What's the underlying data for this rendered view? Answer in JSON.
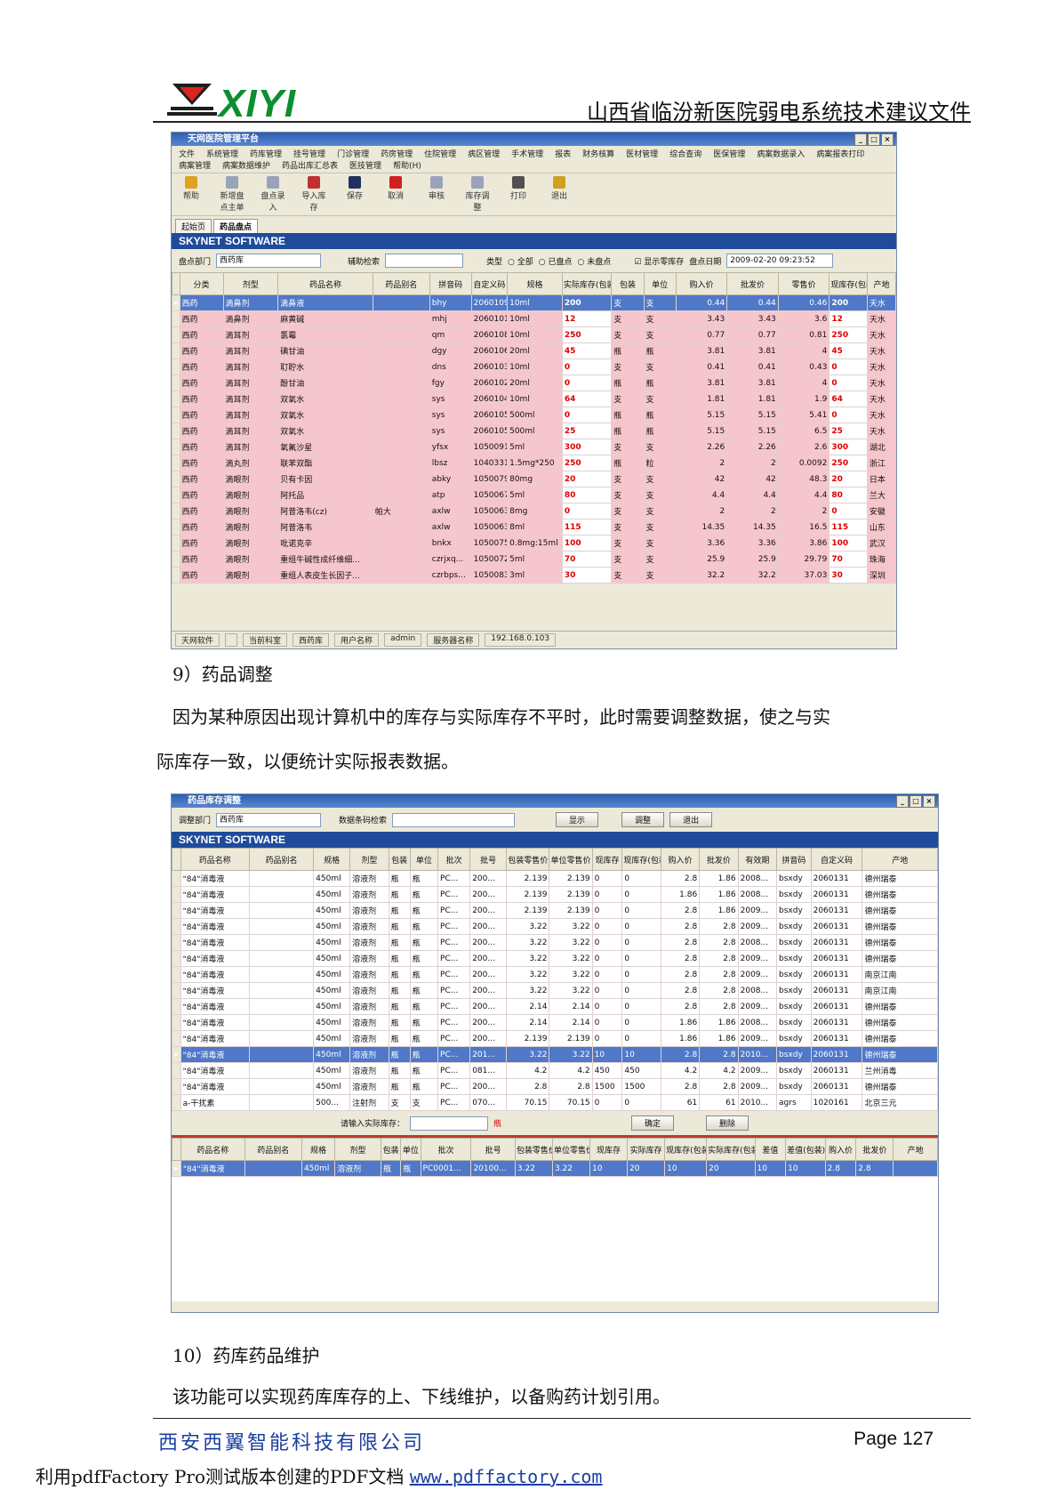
{
  "header": {
    "logo_text": "XIYI",
    "doc_title": "山西省临汾新医院弱电系统技术建议文件"
  },
  "colors": {
    "brand_green": "#0c8f2f",
    "window_blue": "#1f4b9a",
    "row_pink": "#f7c6cc",
    "row_selected": "#4f78c8"
  },
  "win1": {
    "title": "天网医院管理平台",
    "menu": [
      "文件",
      "系统管理",
      "药库管理",
      "挂号管理",
      "门诊管理",
      "药房管理",
      "住院管理",
      "病区管理",
      "手术管理",
      "报表",
      "财务核算",
      "医材管理",
      "综合查询",
      "医保管理",
      "病案数据录入",
      "病案报表打印",
      "病案管理",
      "病案数据维护",
      "药品出库汇总表",
      "医技管理",
      "帮助(H)"
    ],
    "toolbar": [
      "帮助",
      "新增盘点主单",
      "盘点录入",
      "导入库存",
      "保存",
      "取消",
      "审核",
      "库存调整",
      "打印",
      "退出"
    ],
    "tabs": [
      "起始页",
      "药品盘点"
    ],
    "banner": "SKYNET SOFTWARE",
    "filters": {
      "dept_label": "盘点部门",
      "dept_value": "西药库",
      "search_label": "辅助检索",
      "search_value": "",
      "type_label": "类型",
      "type_options": [
        "全部",
        "已盘点",
        "未盘点"
      ],
      "show_zero_label": "显示零库存",
      "date_label": "盘点日期",
      "date_value": "2009-02-20 09:23:52"
    },
    "columns": [
      "分类",
      "剂型",
      "药品名称",
      "药品别名",
      "拼音码",
      "自定义码",
      "规格",
      "实际库存(包装)",
      "包装",
      "单位",
      "购入价",
      "批发价",
      "零售价",
      "现库存(包装)",
      "产地"
    ],
    "rows": [
      [
        "西药",
        "滴鼻剂",
        "滴鼻液",
        "",
        "bhy",
        "2060109",
        "10ml",
        "200",
        "支",
        "支",
        "0.44",
        "0.44",
        "0.46",
        "200",
        "天水"
      ],
      [
        "西药",
        "滴鼻剂",
        "麻黄碱",
        "",
        "mhj",
        "2060101",
        "10ml",
        "12",
        "支",
        "支",
        "3.43",
        "3.43",
        "3.6",
        "12",
        "天水"
      ],
      [
        "西药",
        "滴耳剂",
        "氯霉",
        "",
        "qm",
        "2060108",
        "10ml",
        "250",
        "支",
        "支",
        "0.77",
        "0.77",
        "0.81",
        "250",
        "天水"
      ],
      [
        "西药",
        "滴耳剂",
        "碘甘油",
        "",
        "dgy",
        "2060106",
        "20ml",
        "45",
        "瓶",
        "瓶",
        "3.81",
        "3.81",
        "4",
        "45",
        "天水"
      ],
      [
        "西药",
        "滴耳剂",
        "耵聍水",
        "",
        "dns",
        "2060103",
        "10ml",
        "0",
        "支",
        "支",
        "0.41",
        "0.41",
        "0.43",
        "0",
        "天水"
      ],
      [
        "西药",
        "滴耳剂",
        "酚甘油",
        "",
        "fgy",
        "2060102",
        "20ml",
        "0",
        "瓶",
        "瓶",
        "3.81",
        "3.81",
        "4",
        "0",
        "天水"
      ],
      [
        "西药",
        "滴耳剂",
        "双氧水",
        "",
        "sys",
        "2060104",
        "10ml",
        "64",
        "支",
        "支",
        "1.81",
        "1.81",
        "1.9",
        "64",
        "天水"
      ],
      [
        "西药",
        "滴耳剂",
        "双氧水",
        "",
        "sys",
        "2060105",
        "500ml",
        "0",
        "瓶",
        "瓶",
        "5.15",
        "5.15",
        "5.41",
        "0",
        "天水"
      ],
      [
        "西药",
        "滴耳剂",
        "双氧水",
        "",
        "sys",
        "2060105",
        "500ml",
        "25",
        "瓶",
        "瓶",
        "5.15",
        "5.15",
        "6.5",
        "25",
        "天水"
      ],
      [
        "西药",
        "滴耳剂",
        "氧氟沙星",
        "",
        "yfsx",
        "1050091",
        "5ml",
        "300",
        "支",
        "支",
        "2.26",
        "2.26",
        "2.6",
        "300",
        "湖北"
      ],
      [
        "西药",
        "滴丸剂",
        "联苯双酯",
        "",
        "lbsz",
        "1040331",
        "1.5mg*250",
        "250",
        "瓶",
        "粒",
        "2",
        "2",
        "0.0092",
        "250",
        "浙江"
      ],
      [
        "西药",
        "滴眼剂",
        "贝有卡因",
        "",
        "abky",
        "1050079",
        "80mg",
        "20",
        "支",
        "支",
        "42",
        "42",
        "48.3",
        "20",
        "日本"
      ],
      [
        "西药",
        "滴眼剂",
        "阿托品",
        "",
        "atp",
        "1050067",
        "5ml",
        "80",
        "支",
        "支",
        "4.4",
        "4.4",
        "4.4",
        "80",
        "兰大"
      ],
      [
        "西药",
        "滴眼剂",
        "阿昔洛韦(cz)",
        "帕大",
        "axlw",
        "1050063",
        "8mg",
        "0",
        "支",
        "支",
        "2",
        "2",
        "2",
        "0",
        "安徽"
      ],
      [
        "西药",
        "滴眼剂",
        "阿昔洛韦",
        "",
        "axlw",
        "1050063",
        "8ml",
        "115",
        "支",
        "支",
        "14.35",
        "14.35",
        "16.5",
        "115",
        "山东"
      ],
      [
        "西药",
        "滴眼剂",
        "吡诺克辛",
        "",
        "bnkx",
        "1050075",
        "0.8mg:15ml",
        "100",
        "支",
        "支",
        "3.36",
        "3.36",
        "3.86",
        "100",
        "武汉"
      ],
      [
        "西药",
        "滴眼剂",
        "重组牛碱性成纤维细...",
        "",
        "czrjxq...",
        "1050072",
        "5ml",
        "70",
        "支",
        "支",
        "25.9",
        "25.9",
        "29.79",
        "70",
        "珠海"
      ],
      [
        "西药",
        "滴眼剂",
        "重组人表皮生长因子...",
        "",
        "czrbps...",
        "1050083",
        "3ml",
        "30",
        "支",
        "支",
        "32.2",
        "32.2",
        "37.03",
        "30",
        "深圳"
      ]
    ],
    "status": [
      "天网软件",
      "",
      "当前科室",
      "西药库",
      "用户名称",
      "admin",
      "服务器名称",
      "192.168.0.103"
    ]
  },
  "section9": {
    "heading": "9）药品调整",
    "text1": "因为某种原因出现计算机中的库存与实际库存不平时，此时需要调整数据，使之与实",
    "text2": "际库存一致，以便统计实际报表数据。"
  },
  "win2": {
    "title": "药品库存调整",
    "dept_label": "调整部门",
    "dept_value": "西药库",
    "barcode_label": "数据条码检索",
    "btn_show": "显示",
    "btn_adjust": "调整",
    "btn_exit": "退出",
    "banner": "SKYNET SOFTWARE",
    "columns": [
      "药品名称",
      "药品别名",
      "规格",
      "剂型",
      "包装",
      "单位",
      "批次",
      "批号",
      "包装零售价",
      "单位零售价",
      "现库存",
      "现库存(包装)",
      "购入价",
      "批发价",
      "有效期",
      "拼音码",
      "自定义码",
      "产地"
    ],
    "rows": [
      [
        "\"84\"消毒液",
        "",
        "450ml",
        "溶液剂",
        "瓶",
        "瓶",
        "PC...",
        "200...",
        "2.139",
        "2.139",
        "0",
        "0",
        "2.8",
        "1.86",
        "2008...",
        "bsxdy",
        "2060131",
        "德州瑞泰"
      ],
      [
        "\"84\"消毒液",
        "",
        "450ml",
        "溶液剂",
        "瓶",
        "瓶",
        "PC...",
        "200...",
        "2.139",
        "2.139",
        "0",
        "0",
        "1.86",
        "1.86",
        "2008...",
        "bsxdy",
        "2060131",
        "德州瑞泰"
      ],
      [
        "\"84\"消毒液",
        "",
        "450ml",
        "溶液剂",
        "瓶",
        "瓶",
        "PC...",
        "200...",
        "2.139",
        "2.139",
        "0",
        "0",
        "2.8",
        "1.86",
        "2009...",
        "bsxdy",
        "2060131",
        "德州瑞泰"
      ],
      [
        "\"84\"消毒液",
        "",
        "450ml",
        "溶液剂",
        "瓶",
        "瓶",
        "PC...",
        "200...",
        "3.22",
        "3.22",
        "0",
        "0",
        "2.8",
        "2.8",
        "2009...",
        "bsxdy",
        "2060131",
        "德州瑞泰"
      ],
      [
        "\"84\"消毒液",
        "",
        "450ml",
        "溶液剂",
        "瓶",
        "瓶",
        "PC...",
        "200...",
        "3.22",
        "3.22",
        "0",
        "0",
        "2.8",
        "2.8",
        "2008...",
        "bsxdy",
        "2060131",
        "德州瑞泰"
      ],
      [
        "\"84\"消毒液",
        "",
        "450ml",
        "溶液剂",
        "瓶",
        "瓶",
        "PC...",
        "200...",
        "3.22",
        "3.22",
        "0",
        "0",
        "2.8",
        "2.8",
        "2009...",
        "bsxdy",
        "2060131",
        "德州瑞泰"
      ],
      [
        "\"84\"消毒液",
        "",
        "450ml",
        "溶液剂",
        "瓶",
        "瓶",
        "PC...",
        "200...",
        "3.22",
        "3.22",
        "0",
        "0",
        "2.8",
        "2.8",
        "2009...",
        "bsxdy",
        "2060131",
        "南京江南"
      ],
      [
        "\"84\"消毒液",
        "",
        "450ml",
        "溶液剂",
        "瓶",
        "瓶",
        "PC...",
        "200...",
        "3.22",
        "3.22",
        "0",
        "0",
        "2.8",
        "2.8",
        "2008...",
        "bsxdy",
        "2060131",
        "南京江南"
      ],
      [
        "\"84\"消毒液",
        "",
        "450ml",
        "溶液剂",
        "瓶",
        "瓶",
        "PC...",
        "200...",
        "2.14",
        "2.14",
        "0",
        "0",
        "2.8",
        "2.8",
        "2009...",
        "bsxdy",
        "2060131",
        "德州瑞泰"
      ],
      [
        "\"84\"消毒液",
        "",
        "450ml",
        "溶液剂",
        "瓶",
        "瓶",
        "PC...",
        "200...",
        "2.14",
        "2.14",
        "0",
        "0",
        "1.86",
        "1.86",
        "2008...",
        "bsxdy",
        "2060131",
        "德州瑞泰"
      ],
      [
        "\"84\"消毒液",
        "",
        "450ml",
        "溶液剂",
        "瓶",
        "瓶",
        "PC...",
        "200...",
        "2.139",
        "2.139",
        "0",
        "0",
        "1.86",
        "1.86",
        "2009...",
        "bsxdy",
        "2060131",
        "德州瑞泰"
      ],
      [
        "\"84\"消毒液",
        "",
        "450ml",
        "溶液剂",
        "瓶",
        "瓶",
        "PC...",
        "201...",
        "3.22",
        "3.22",
        "10",
        "10",
        "2.8",
        "2.8",
        "2010...",
        "bsxdy",
        "2060131",
        "德州瑞泰"
      ],
      [
        "\"84\"消毒液",
        "",
        "450ml",
        "溶液剂",
        "瓶",
        "瓶",
        "PC...",
        "081...",
        "4.2",
        "4.2",
        "450",
        "450",
        "4.2",
        "4.2",
        "2009...",
        "bsxdy",
        "2060131",
        "兰州消毒"
      ],
      [
        "\"84\"消毒液",
        "",
        "450ml",
        "溶液剂",
        "瓶",
        "瓶",
        "PC...",
        "200...",
        "2.8",
        "2.8",
        "1500",
        "1500",
        "2.8",
        "2.8",
        "2009...",
        "bsxdy",
        "2060131",
        "德州瑞泰"
      ],
      [
        "a-干扰素",
        "",
        "500...",
        "注射剂",
        "支",
        "支",
        "PC...",
        "070...",
        "70.15",
        "70.15",
        "0",
        "0",
        "61",
        "61",
        "2010...",
        "agrs",
        "1020161",
        "北京三元"
      ]
    ],
    "selected_index": 11,
    "input_label": "请输入实际库存：",
    "unit_word": "瓶",
    "btn_confirm": "确定",
    "btn_delete": "删除",
    "detail_columns": [
      "药品名称",
      "药品别名",
      "规格",
      "剂型",
      "包装",
      "单位",
      "批次",
      "批号",
      "包装零售价",
      "单位零售价",
      "现库存",
      "实际库存",
      "现库存(包装)",
      "实际库存(包装)",
      "差值",
      "差值(包装)",
      "购入价",
      "批发价",
      "产地"
    ],
    "detail_row": [
      "\"84\"消毒液",
      "",
      "450ml",
      "溶液剂",
      "瓶",
      "瓶",
      "PC0001...",
      "20100...",
      "3.22",
      "3.22",
      "10",
      "20",
      "10",
      "20",
      "10",
      "10",
      "2.8",
      "2.8",
      ""
    ]
  },
  "section10": {
    "heading": "10）药库药品维护",
    "text": "该功能可以实现药库库存的上、下线维护，以备购药计划引用。"
  },
  "footer": {
    "company": "西安西翼智能科技有限公司",
    "page": "Page 127",
    "pdf_note": "利用pdfFactory Pro测试版本创建的PDF文档",
    "pdf_link": "www.pdffactory.com"
  }
}
